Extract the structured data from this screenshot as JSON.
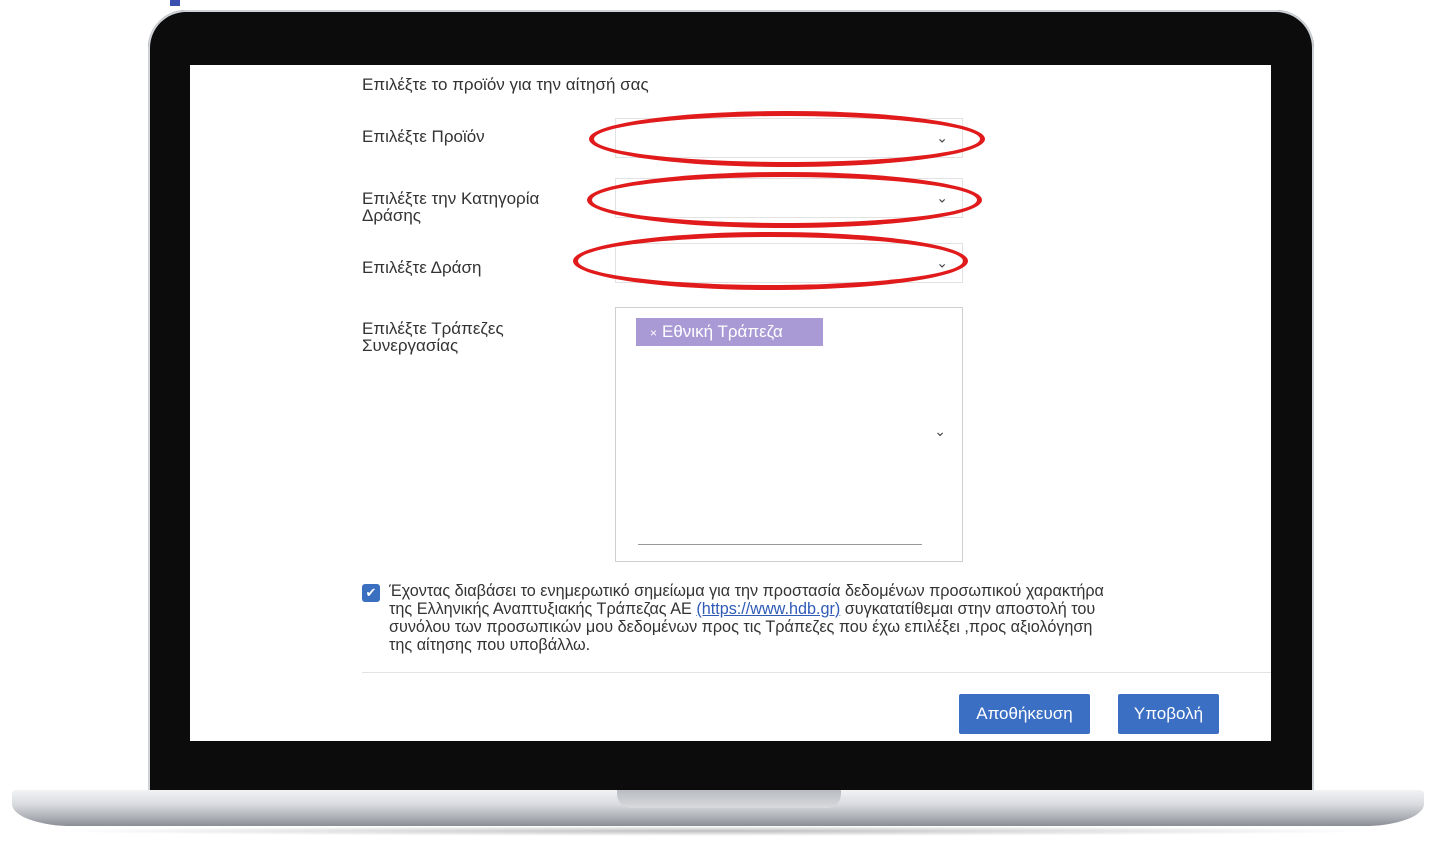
{
  "form": {
    "heading": "Επιλέξτε το προϊόν για την αίτησή σας",
    "product_label": "Επιλέξτε Προϊόν",
    "category_label": "Επιλέξτε την Κατηγορία Δράσης",
    "action_label": "Επιλέξτε Δράση",
    "banks_label": "Επιλέξτε Τράπεζες Συνεργασίας",
    "selected_bank": "Εθνική Τράπεζα",
    "tag_remove": "×",
    "chevron": "⌄"
  },
  "consent": {
    "checked": true,
    "check_glyph": "✔",
    "text_before": "Έχοντας διαβάσει το ενημερωτικό σημείωμα για την προστασία δεδομένων προσωπικού χαρακτήρα της Ελληνικής Αναπτυξιακής Τράπεζας ΑΕ ",
    "link": "(https://www.hdb.gr)",
    "text_after": " συγκατατίθεμαι στην αποστολή του συνόλου των προσωπικών μου δεδομένων προς τις Τράπεζες που έχω επιλέξει ,προς αξιολόγηση της αίτησης που υποβάλλω."
  },
  "buttons": {
    "save": "Αποθήκευση",
    "submit": "Υποβολή"
  },
  "colors": {
    "annotation_ring": "#e11b1b",
    "tag_bg": "#a99ad6",
    "button_bg": "#3a6fc4"
  }
}
